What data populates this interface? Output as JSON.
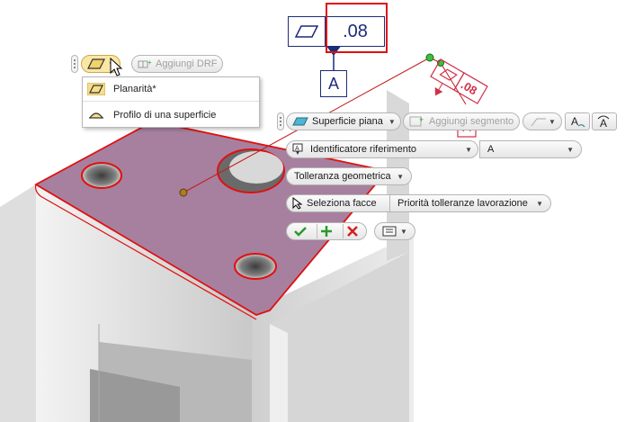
{
  "gdt_frame": {
    "tolerance_value": ".08",
    "datum_label": "A",
    "symbol_icon": "flatness-icon"
  },
  "preview_frame": {
    "tolerance_value": ".08",
    "datum_label": "A"
  },
  "top_toolbar": {
    "type_icon": "flatness-icon",
    "add_drf_label": "Aggiungi DRF",
    "add_drf_icon": "add-drf-icon"
  },
  "dropdown_menu": {
    "items": [
      {
        "label": "Planarità*",
        "icon": "flatness-icon"
      },
      {
        "label": "Profilo di una superficie",
        "icon": "surface-profile-icon"
      }
    ]
  },
  "feature_toolbar": {
    "surface_type": "Superficie piana",
    "surface_icon": "plane-surface-icon",
    "add_segment_label": "Aggiungi segmento",
    "text_style_icon": "text-style-icon",
    "text_edit_icon": "text-edit-icon"
  },
  "datum_row": {
    "identifier_label": "Identificatore riferimento",
    "identifier_value": "A"
  },
  "tolerance_row": {
    "label": "Tolleranza geometrica"
  },
  "select_row": {
    "select_faces_label": "Seleziona facce",
    "priority_label": "Priorità tolleranze lavorazione"
  },
  "actions": {
    "ok_icon": "check-icon",
    "add_icon": "plus-icon",
    "cancel_icon": "x-icon",
    "options_icon": "options-menu-icon"
  },
  "colors": {
    "highlight_red": "#e01010",
    "gdt_blue": "#1c2b7a",
    "face_purple": "#a7809f",
    "accent_green": "#2a9a2a"
  }
}
